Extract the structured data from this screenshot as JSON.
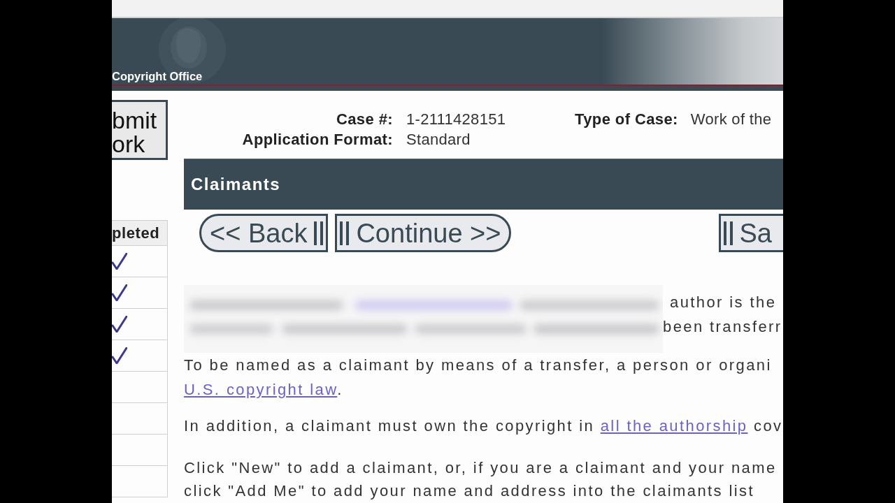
{
  "header": {
    "title": "Copyright Office"
  },
  "sidebar": {
    "submit_button": {
      "label": "bmit ork"
    },
    "status_table": {
      "column": "pleted",
      "rows": [
        {
          "completed": true
        },
        {
          "completed": true
        },
        {
          "completed": true
        },
        {
          "completed": true
        },
        {
          "completed": false
        },
        {
          "completed": false
        },
        {
          "completed": false
        },
        {
          "completed": false
        }
      ]
    }
  },
  "case_info": {
    "rows": [
      {
        "fields": [
          {
            "label": "Case #:",
            "value": "1-2111428151"
          },
          {
            "label": "Type of Case:",
            "value": "Work of the"
          }
        ]
      },
      {
        "fields": [
          {
            "label": "Application Format:",
            "value": "Standard"
          }
        ]
      }
    ]
  },
  "section": {
    "title": "Claimants"
  },
  "nav_buttons": [
    {
      "kind": "back",
      "label": "<< Back"
    },
    {
      "kind": "continue",
      "label": "Continue >>"
    },
    {
      "kind": "save",
      "label": "Sa"
    }
  ],
  "content": [
    {
      "kind": "obscured",
      "lines": [
        "author is the",
        "been transferr"
      ]
    },
    {
      "kind": "paragraph",
      "lines": [
        [
          {
            "kind": "text",
            "text": "To be named as a claimant by means of a transfer, a person or organi"
          }
        ],
        [
          {
            "kind": "link",
            "text": "U.S. copyright law"
          },
          {
            "kind": "text",
            "text": "."
          }
        ]
      ]
    },
    {
      "kind": "paragraph",
      "lines": [
        [
          {
            "kind": "text",
            "text": "In addition, a claimant must own the copyright in "
          },
          {
            "kind": "link",
            "text": "all the authorship"
          },
          {
            "kind": "text",
            "text": " cov"
          }
        ]
      ]
    },
    {
      "kind": "paragraph",
      "lines": [
        [
          {
            "kind": "text",
            "text": "Click \"New\" to add a claimant, or, if you are a claimant and your name"
          }
        ],
        [
          {
            "kind": "text",
            "text": "click \"Add Me\" to add your name and address into the claimants list"
          }
        ]
      ]
    }
  ]
}
